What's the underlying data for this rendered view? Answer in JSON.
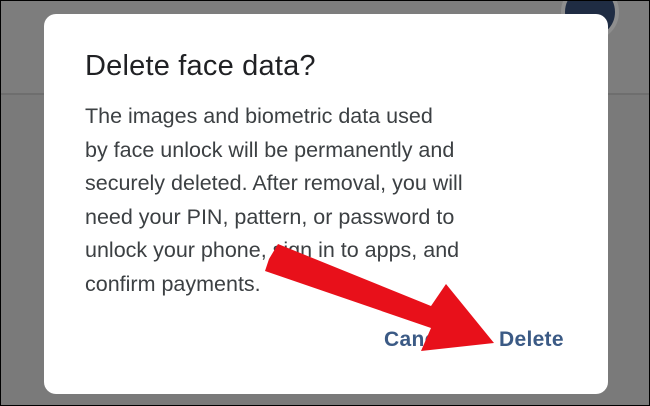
{
  "dialog": {
    "title": "Delete face data?",
    "body_lines": [
      "The images and biometric data used",
      "by face unlock will be permanently and",
      "securely deleted. After removal, you will",
      "need your PIN, pattern, or password to",
      "unlock your phone, sign in to apps, and",
      "confirm payments."
    ],
    "cancel_label": "Cancel",
    "delete_label": "Delete"
  },
  "colors": {
    "accent": "#3b5a85",
    "annotation_arrow": "#e8101a",
    "scrim": "#7a7a7a"
  },
  "annotation": {
    "icon": "red-arrow-icon",
    "points_to": "delete-button"
  }
}
